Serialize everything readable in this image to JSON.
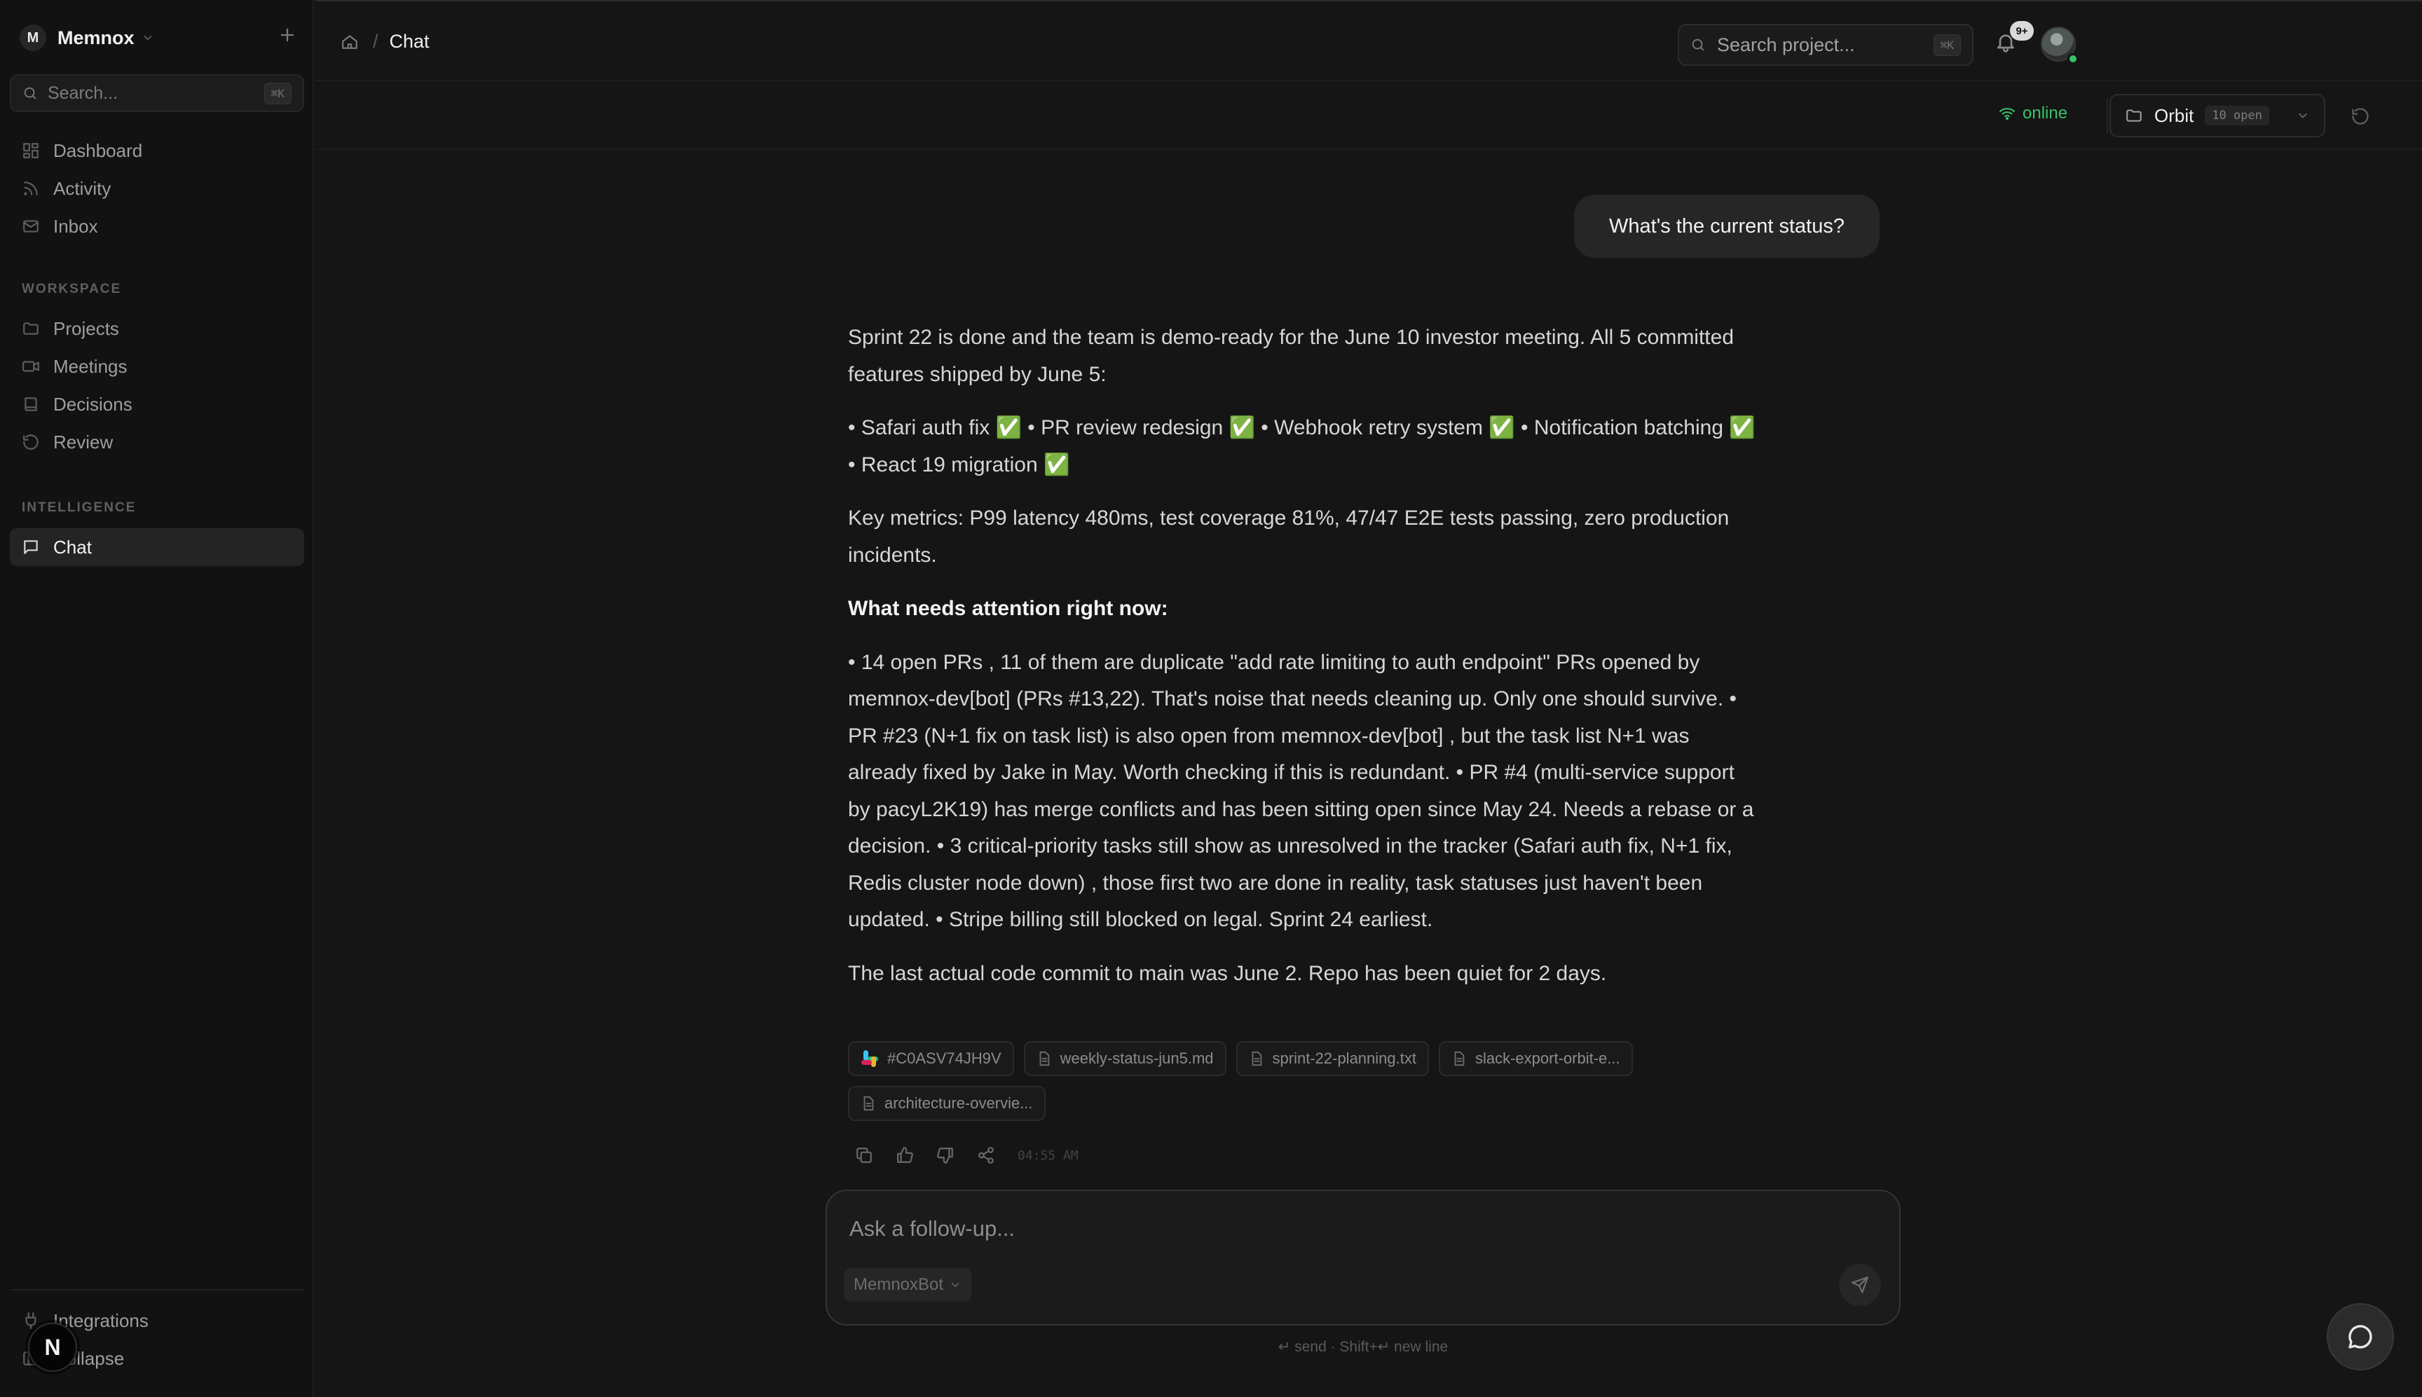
{
  "workspace": {
    "initial": "M",
    "name": "Memnox"
  },
  "sidebar": {
    "search_placeholder": "Search...",
    "search_shortcut": "⌘K",
    "primary_items": [
      {
        "label": "Dashboard",
        "icon": "grid-icon"
      },
      {
        "label": "Activity",
        "icon": "rss-icon"
      },
      {
        "label": "Inbox",
        "icon": "mail-icon"
      }
    ],
    "workspace_label": "WORKSPACE",
    "workspace_items": [
      {
        "label": "Projects",
        "icon": "folder-icon"
      },
      {
        "label": "Meetings",
        "icon": "video-icon"
      },
      {
        "label": "Decisions",
        "icon": "book-icon"
      },
      {
        "label": "Review",
        "icon": "rotate-icon"
      }
    ],
    "intelligence_label": "INTELLIGENCE",
    "intelligence_items": [
      {
        "label": "Chat",
        "icon": "message-icon",
        "active": true
      }
    ],
    "bottom_items": [
      {
        "label": "Integrations",
        "icon": "plug-icon"
      },
      {
        "label": "Collapse",
        "icon": "collapse-icon"
      }
    ],
    "floating_badge": "N"
  },
  "header": {
    "breadcrumb_current": "Chat",
    "search_placeholder": "Search project...",
    "search_shortcut": "⌘K",
    "notifications_badge": "9+"
  },
  "toolbar": {
    "status": "online",
    "status_color": "#39c26a",
    "project_name": "Orbit",
    "project_open": "10 open"
  },
  "chat": {
    "user_message": "What's the current status?",
    "answer_paragraphs": [
      {
        "text": "Sprint 22 is done and the team is demo-ready for the June 10 investor meeting. All 5 committed features shipped by June 5:",
        "bold": false
      },
      {
        "text": "• Safari auth fix ✅ • PR review redesign ✅ • Webhook retry system ✅ • Notification batching ✅ • React 19 migration ✅",
        "bold": false
      },
      {
        "text": "Key metrics: P99 latency 480ms, test coverage 81%, 47/47 E2E tests passing, zero production incidents.",
        "bold": false
      },
      {
        "text": "What needs attention right now:",
        "bold": true
      },
      {
        "text": "• 14 open PRs , 11 of them are duplicate \"add rate limiting to auth endpoint\" PRs opened by memnox-dev[bot] (PRs #13,22). That's noise that needs cleaning up. Only one should survive. • PR #23 (N+1 fix on task list) is also open from memnox-dev[bot] , but the task list N+1 was already fixed by Jake in May. Worth checking if this is redundant. • PR #4 (multi-service support by pacyL2K19) has merge conflicts and has been sitting open since May 24. Needs a rebase or a decision. • 3 critical-priority tasks still show as unresolved in the tracker (Safari auth fix, N+1 fix, Redis cluster node down) , those first two are done in reality, task statuses just haven't been updated. • Stripe billing still blocked on legal. Sprint 24 earliest.",
        "bold": false
      },
      {
        "text": "The last actual code commit to main was June 2. Repo has been quiet for 2 days.",
        "bold": false
      }
    ],
    "sources": [
      {
        "label": "#C0ASV74JH9V",
        "icon": "slack-icon"
      },
      {
        "label": "weekly-status-jun5.md",
        "icon": "file-icon"
      },
      {
        "label": "sprint-22-planning.txt",
        "icon": "file-icon"
      },
      {
        "label": "slack-export-orbit-e...",
        "icon": "file-icon"
      },
      {
        "label": "architecture-overvie...",
        "icon": "file-icon"
      }
    ],
    "timestamp": "04:55 AM"
  },
  "composer": {
    "placeholder": "Ask a follow-up...",
    "model": "MemnoxBot",
    "hint": "↵ send · Shift+↵ new line"
  }
}
